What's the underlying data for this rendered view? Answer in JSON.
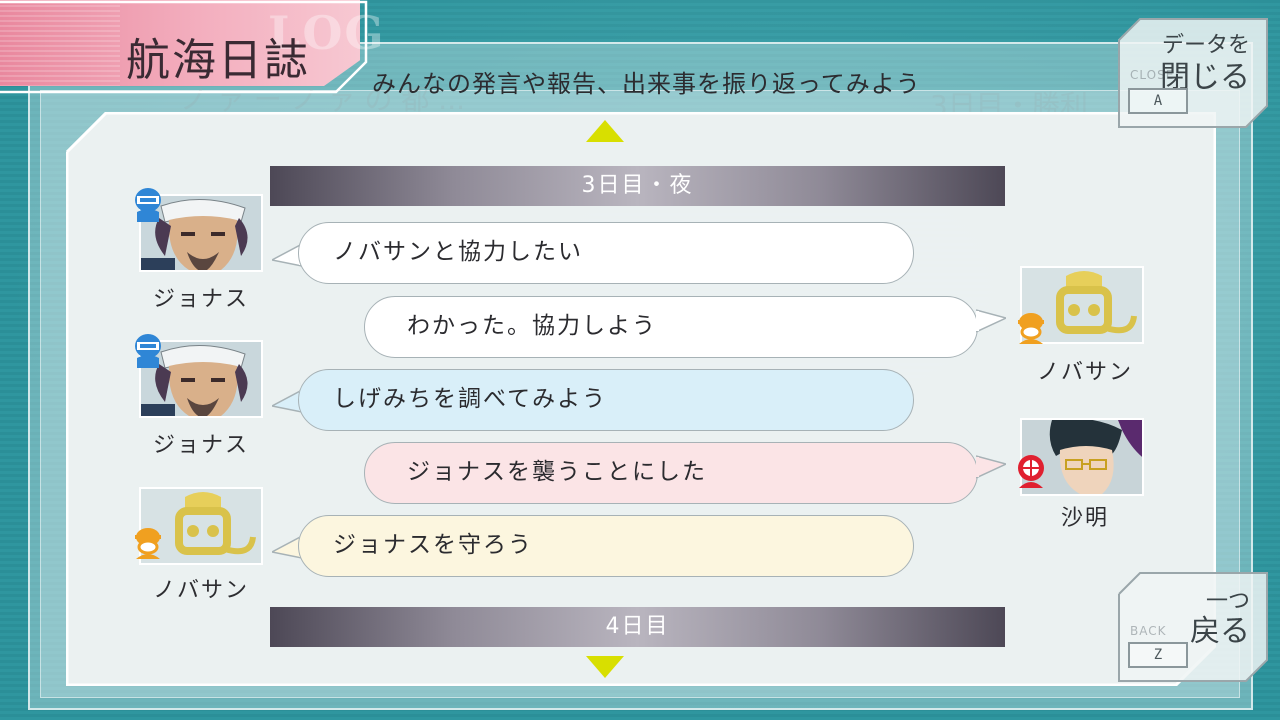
{
  "header": {
    "title": "航海日誌",
    "title_ghost": "LOG",
    "subtitle": "みんなの発言や報告、出来事を振り返ってみよう"
  },
  "close_button": {
    "ghost": "CLOSE",
    "line1": "データを",
    "line2": "閉じる",
    "key": "A"
  },
  "back_button": {
    "ghost": "BACK",
    "line1": "一つ",
    "line2": "戻る",
    "key": "Z"
  },
  "log": {
    "day_headers": [
      "3日目・夜",
      "4日目"
    ],
    "entries": [
      {
        "speaker": "ジョナス",
        "side": "left",
        "text": "ノバサンと協力したい",
        "bubble_color": "white",
        "role_icon": "cyborg-icon"
      },
      {
        "speaker": "ノバサン",
        "side": "right",
        "text": "わかった。協力しよう",
        "bubble_color": "white",
        "role_icon": "monkey-icon"
      },
      {
        "speaker": "ジョナス",
        "side": "left",
        "text": "しげみちを調べてみよう",
        "bubble_color": "blue",
        "role_icon": "cyborg-icon"
      },
      {
        "speaker": "沙明",
        "side": "right",
        "text": "ジョナスを襲うことにした",
        "bubble_color": "pink",
        "role_icon": "gnosia-icon"
      },
      {
        "speaker": "ノバサン",
        "side": "left",
        "text": "ジョナスを守ろう",
        "bubble_color": "yellow",
        "role_icon": "monkey-icon"
      }
    ]
  },
  "colors": {
    "accent_arrow": "#d8df00",
    "title_tab": "#f3aebe",
    "background": "#2f969f"
  }
}
